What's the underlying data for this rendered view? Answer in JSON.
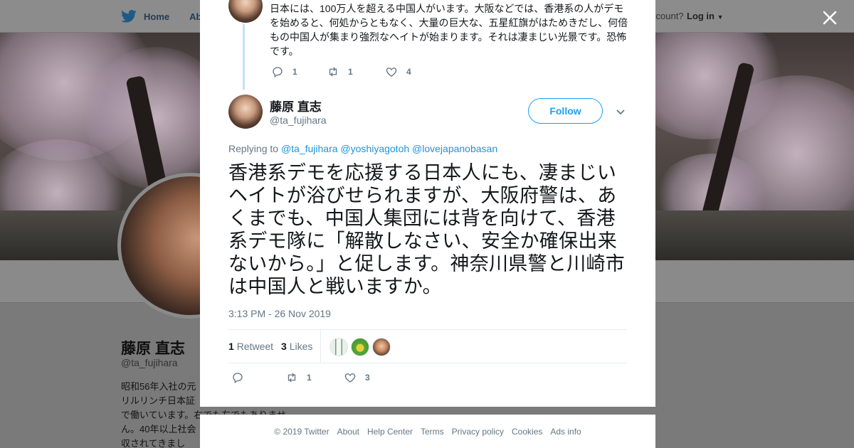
{
  "background": {
    "nav": {
      "home": "Home",
      "about": "Abo",
      "account_prompt": "ccount?",
      "login": "Log in"
    },
    "profile": {
      "name": "藤原 直志",
      "handle": "@ta_fujihara",
      "bio_lines": [
        "昭和56年入社の元",
        "リルリンチ日本証",
        "で働いています。右でも左でもありませ",
        "ん。40年以上社会",
        "収されてきまし"
      ]
    },
    "icons": {
      "bird": "twitter-bird-icon",
      "close": "close-icon"
    }
  },
  "previous_tweet": {
    "text": "日本には、100万人を超える中国人がいます。大阪などでは、香港系の人がデモを始めると、何処からともなく、大量の巨大な、五星紅旗がはためきだし、何倍もの中国人が集まり強烈なヘイトが始まります。それは凄まじい光景です。恐怖です。",
    "replies": "1",
    "retweets": "1",
    "likes": "4"
  },
  "tweet": {
    "author_name": "藤原 直志",
    "author_handle": "@ta_fujihara",
    "follow_label": "Follow",
    "replying_label": "Replying to",
    "mentions": [
      "@ta_fujihara",
      "@yoshiyagotoh",
      "@lovejapanobasan"
    ],
    "text": "香港系デモを応援する日本人にも、凄まじいヘイトが浴びせられますが、大阪府警は、あくまでも、中国人集団には背を向けて、香港系デモ隊に「解散しなさい、安全か確保出来ないから。」と促します。神奈川県警と川崎市は中国人と戦いますか。",
    "timestamp": "3:13 PM - 26 Nov 2019",
    "retweet_count": "1",
    "retweet_label": "Retweet",
    "like_count": "3",
    "like_label": "Likes",
    "actions": {
      "retweets": "1",
      "likes": "3"
    }
  },
  "footer": {
    "links": [
      "© 2019 Twitter",
      "About",
      "Help Center",
      "Terms",
      "Privacy policy",
      "Cookies",
      "Ads info"
    ]
  },
  "colors": {
    "accent": "#1da1f2",
    "link": "#1b95e0",
    "muted": "#657786",
    "thread_line": "#c4e1f5"
  }
}
